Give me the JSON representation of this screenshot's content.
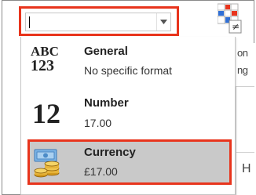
{
  "format_box": {
    "value": ""
  },
  "formats": [
    {
      "glyph_top": "ABC",
      "glyph_bottom": "123",
      "title": "General",
      "sample": "No specific format",
      "icon": "abc-123-icon"
    },
    {
      "glyph": "12",
      "title": "Number",
      "sample": "17.00",
      "icon": "number-12-icon"
    },
    {
      "title": "Currency",
      "sample": "£17.00",
      "icon": "currency-icon",
      "selected": true
    }
  ],
  "background": {
    "row1": "on",
    "row2": "ng",
    "cell": "H"
  },
  "colors": {
    "highlight": "#e8341c",
    "selected_bg": "#c9c9c9"
  }
}
